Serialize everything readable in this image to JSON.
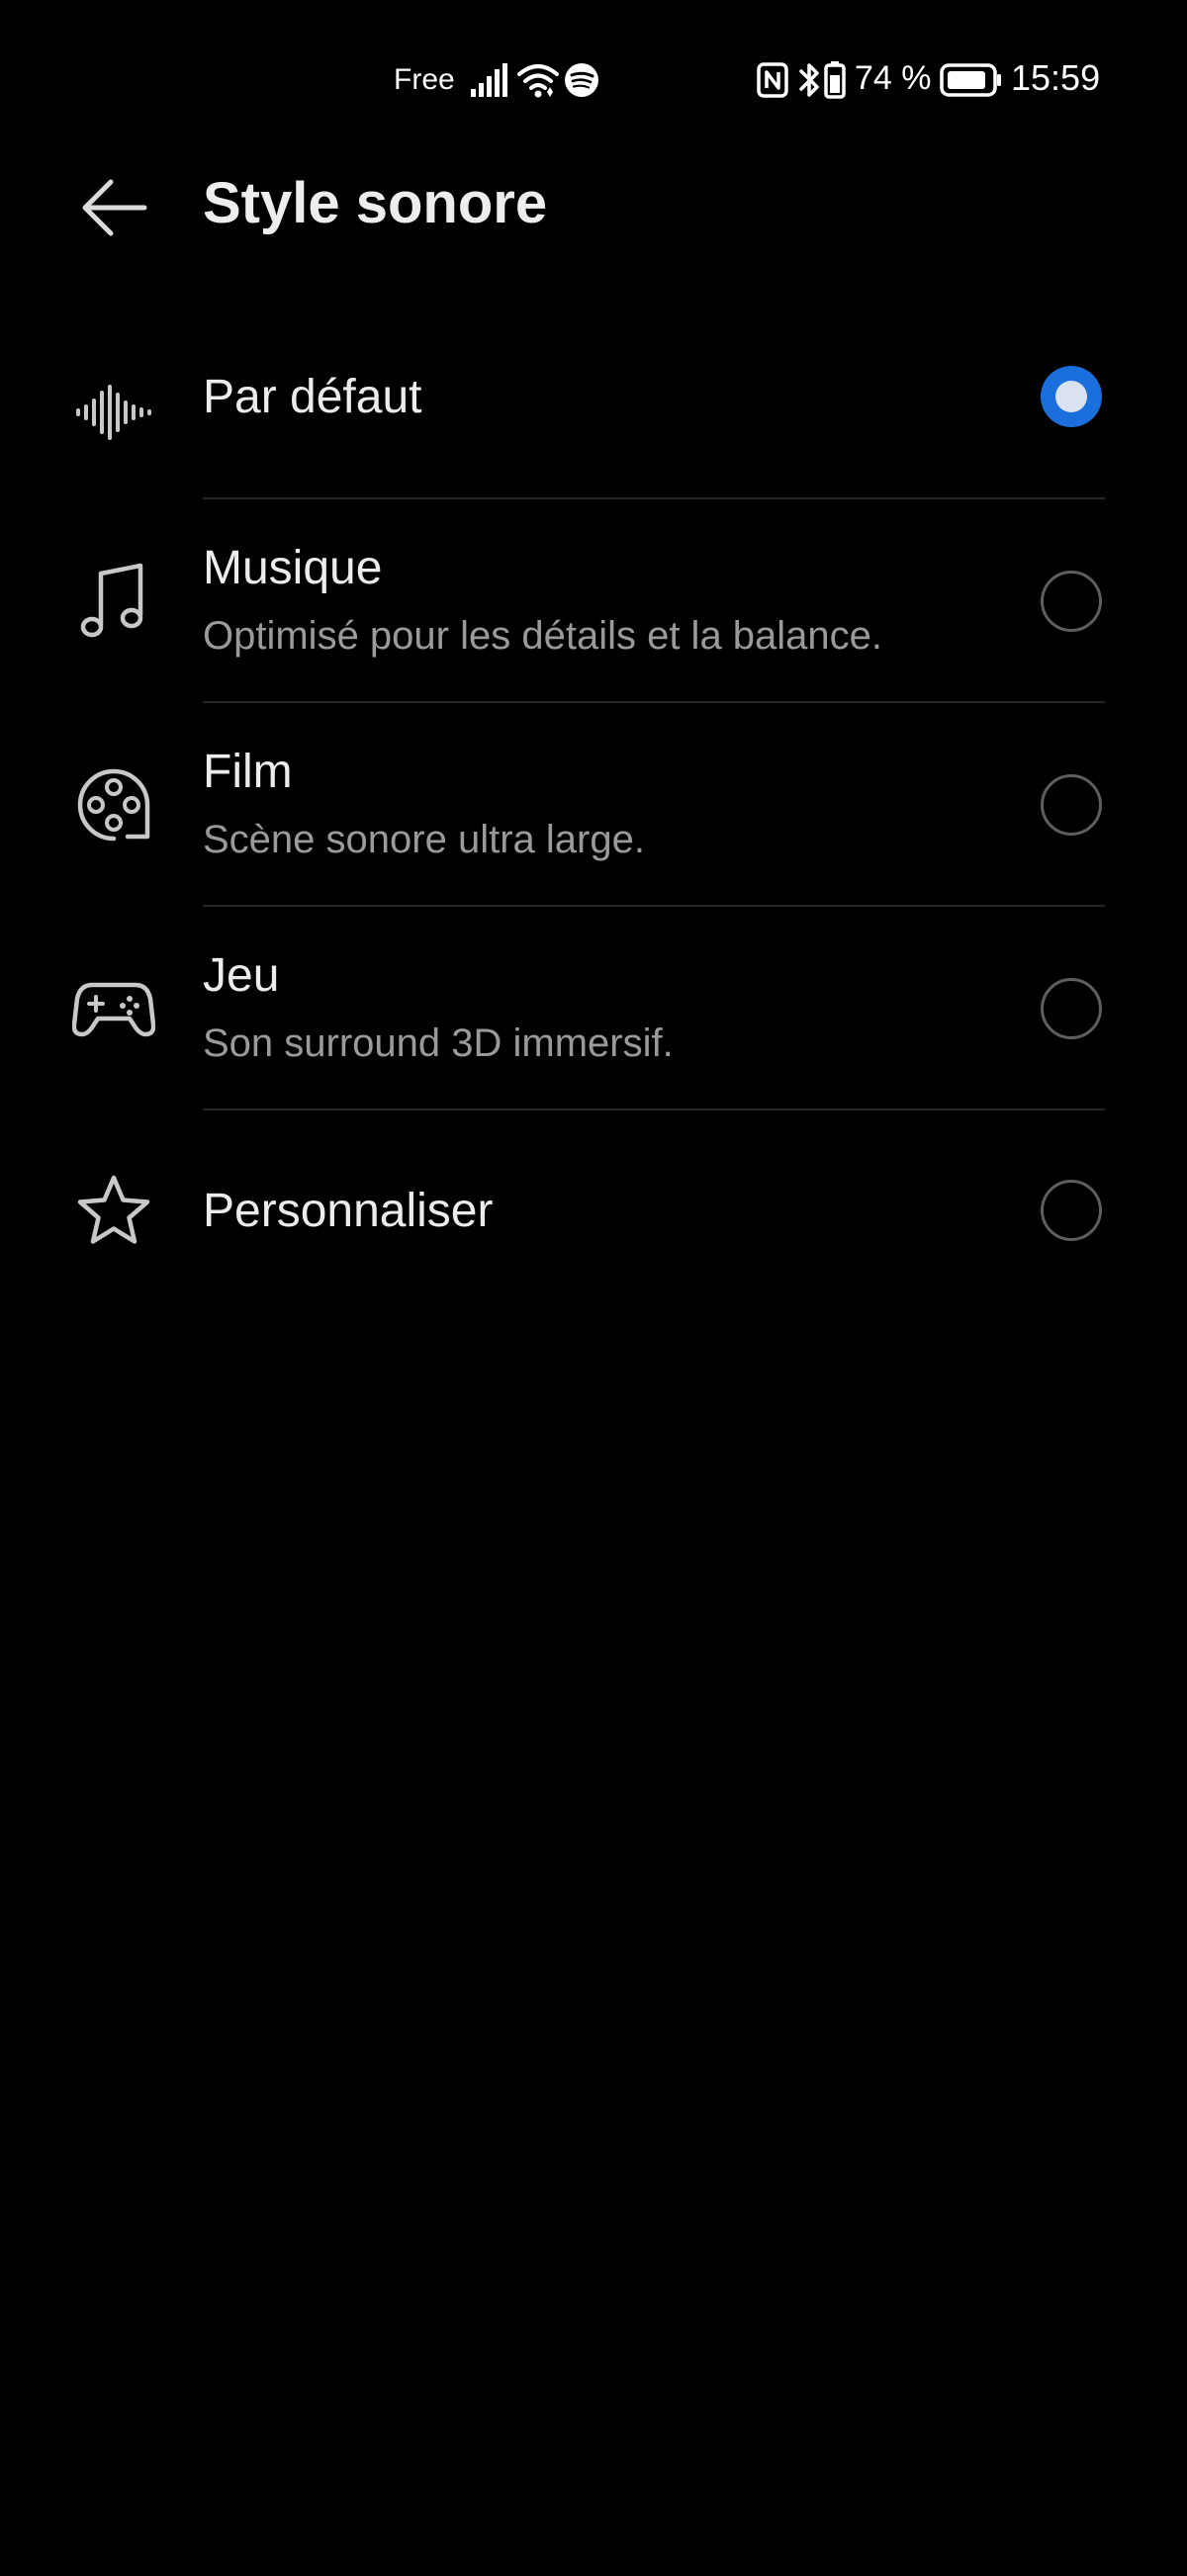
{
  "status_bar": {
    "carrier": "Free",
    "battery_percent": "74 %",
    "time": "15:59",
    "icons": [
      "signal-icon",
      "wifi-icon",
      "spotify-icon",
      "nfc-icon",
      "bluetooth-icon",
      "battery-saver-icon",
      "battery-icon"
    ]
  },
  "header": {
    "back_icon": "arrow-left-icon",
    "title": "Style sonore"
  },
  "options": [
    {
      "title": "Par défaut",
      "subtitle": "",
      "icon": "waveform-icon",
      "selected": true
    },
    {
      "title": "Musique",
      "subtitle": "Optimisé pour les détails et la balance.",
      "icon": "music-note-icon",
      "selected": false
    },
    {
      "title": "Film",
      "subtitle": "Scène sonore ultra large.",
      "icon": "film-reel-icon",
      "selected": false
    },
    {
      "title": "Jeu",
      "subtitle": "Son surround 3D immersif.",
      "icon": "gamepad-icon",
      "selected": false
    },
    {
      "title": "Personnaliser",
      "subtitle": "",
      "icon": "star-icon",
      "selected": false
    }
  ],
  "colors": {
    "background": "#000000",
    "accent": "#1a6fdc",
    "title_text": "#ececec",
    "subtitle_text": "#9a9a9a"
  }
}
